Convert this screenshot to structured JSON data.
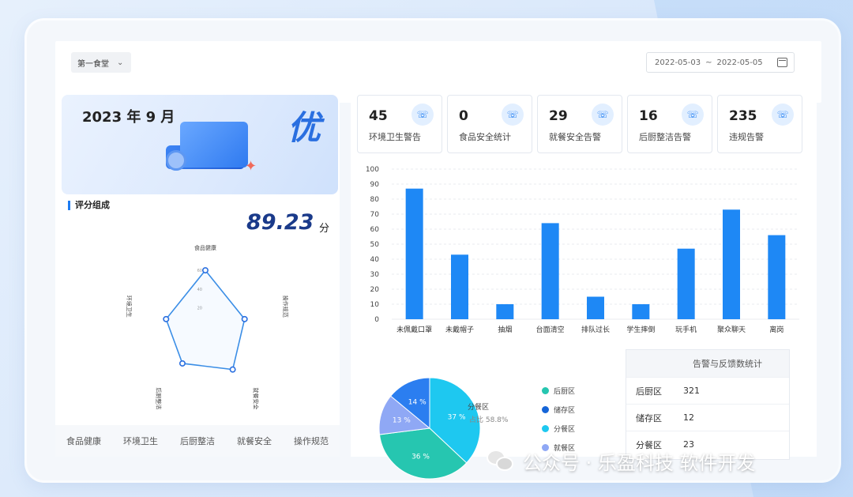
{
  "filter": {
    "canteen": "第一食堂",
    "date_start": "2022-05-03",
    "date_sep": "~",
    "date_end": "2022-05-05"
  },
  "banner": {
    "year_month": "2023 年 9 月",
    "grade": "优"
  },
  "score": {
    "title": "评分组成",
    "value": "89.23",
    "unit": "分"
  },
  "radar": {
    "axes": [
      "食品健康",
      "操作规范",
      "就餐安全",
      "后厨整洁",
      "环境卫生"
    ],
    "scale_labels": [
      "60",
      "40",
      "20"
    ],
    "values": [
      0.82,
      0.55,
      0.62,
      0.52,
      0.55
    ],
    "bottom_labels": [
      "食品健康",
      "环境卫生",
      "后厨整洁",
      "就餐安全",
      "操作规范"
    ]
  },
  "stats": [
    {
      "value": "45",
      "label": "环境卫生警告"
    },
    {
      "value": "0",
      "label": "食品安全统计"
    },
    {
      "value": "29",
      "label": "就餐安全告警"
    },
    {
      "value": "16",
      "label": "后厨整洁告警"
    },
    {
      "value": "235",
      "label": "违规告警"
    }
  ],
  "chart_data": [
    {
      "type": "bar",
      "categories": [
        "未佩戴口罩",
        "未戴帽子",
        "抽烟",
        "台面清空",
        "排队过长",
        "学生摔倒",
        "玩手机",
        "聚众聊天",
        "离岗"
      ],
      "values": [
        87,
        43,
        10,
        64,
        15,
        10,
        47,
        73,
        56
      ],
      "ylim": [
        0,
        100
      ],
      "yticks": [
        0,
        10,
        20,
        30,
        40,
        50,
        60,
        70,
        80,
        90,
        100
      ],
      "color": "#1e88f5"
    },
    {
      "type": "pie",
      "labels": [
        "分餐区",
        "后厨区",
        "储存区",
        "就餐区"
      ],
      "values": [
        37,
        36,
        13,
        14
      ],
      "slice_labels": [
        "37 %",
        "36 %",
        "13 %",
        "14 %"
      ],
      "colors": [
        "#1ec8f0",
        "#26c6b0",
        "#8fa8f5",
        "#2b7ef0"
      ],
      "callout": {
        "label": "分餐区",
        "ratio": "占比 58.8%"
      }
    }
  ],
  "pie_legend": [
    {
      "label": "后厨区",
      "color": "#26c6b0"
    },
    {
      "label": "储存区",
      "color": "#1565d8"
    },
    {
      "label": "分餐区",
      "color": "#1ec8f0"
    },
    {
      "label": "就餐区",
      "color": "#8fa8f5"
    }
  ],
  "table": {
    "title": "告警与反馈数统计",
    "rows": [
      {
        "area": "后厨区",
        "count": "321"
      },
      {
        "area": "储存区",
        "count": "12"
      },
      {
        "area": "分餐区",
        "count": "23"
      }
    ]
  },
  "watermark": "公众号 · 乐盈科技 软件开发"
}
